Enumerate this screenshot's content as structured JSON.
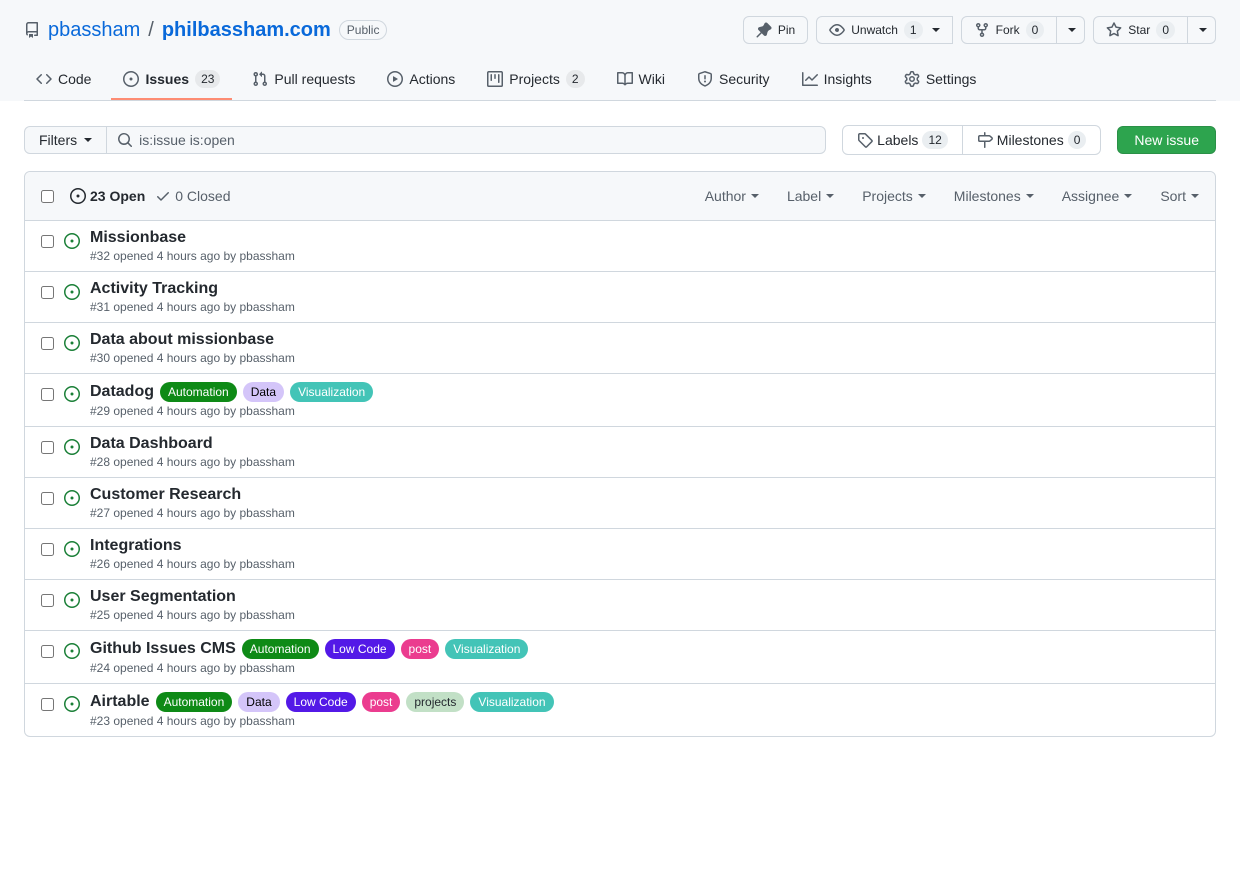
{
  "repo": {
    "owner": "pbassham",
    "name": "philbassham.com",
    "visibility": "Public"
  },
  "actions": {
    "pin": "Pin",
    "unwatch": "Unwatch",
    "watch_count": "1",
    "fork": "Fork",
    "fork_count": "0",
    "star": "Star",
    "star_count": "0"
  },
  "tabs": {
    "code": "Code",
    "issues": "Issues",
    "issues_count": "23",
    "pulls": "Pull requests",
    "actions": "Actions",
    "projects": "Projects",
    "projects_count": "2",
    "wiki": "Wiki",
    "security": "Security",
    "insights": "Insights",
    "settings": "Settings"
  },
  "filters": {
    "button": "Filters",
    "query": "is:issue is:open",
    "labels": "Labels",
    "labels_count": "12",
    "milestones": "Milestones",
    "milestones_count": "0",
    "new_issue": "New issue"
  },
  "list_header": {
    "open": "23 Open",
    "closed": "0 Closed",
    "author": "Author",
    "label": "Label",
    "projects": "Projects",
    "milestones": "Milestones",
    "assignee": "Assignee",
    "sort": "Sort"
  },
  "label_colors": {
    "Automation": {
      "bg": "#0e8a16",
      "fg": "#ffffff"
    },
    "Data": {
      "bg": "#d4c5f9",
      "fg": "#000000"
    },
    "Visualization": {
      "bg": "#43c4b7",
      "fg": "#ffffff"
    },
    "Low Code": {
      "bg": "#5319e7",
      "fg": "#ffffff"
    },
    "post": {
      "bg": "#eb3c8f",
      "fg": "#ffffff"
    },
    "projects": {
      "bg": "#c2e0c6",
      "fg": "#24292f"
    }
  },
  "issues": [
    {
      "title": "Missionbase",
      "number": "32",
      "time": "4 hours ago",
      "author": "pbassham",
      "labels": []
    },
    {
      "title": "Activity Tracking",
      "number": "31",
      "time": "4 hours ago",
      "author": "pbassham",
      "labels": []
    },
    {
      "title": "Data about missionbase",
      "number": "30",
      "time": "4 hours ago",
      "author": "pbassham",
      "labels": []
    },
    {
      "title": "Datadog",
      "number": "29",
      "time": "4 hours ago",
      "author": "pbassham",
      "labels": [
        "Automation",
        "Data",
        "Visualization"
      ]
    },
    {
      "title": "Data Dashboard",
      "number": "28",
      "time": "4 hours ago",
      "author": "pbassham",
      "labels": []
    },
    {
      "title": "Customer Research",
      "number": "27",
      "time": "4 hours ago",
      "author": "pbassham",
      "labels": []
    },
    {
      "title": "Integrations",
      "number": "26",
      "time": "4 hours ago",
      "author": "pbassham",
      "labels": []
    },
    {
      "title": "User Segmentation",
      "number": "25",
      "time": "4 hours ago",
      "author": "pbassham",
      "labels": []
    },
    {
      "title": "Github Issues CMS",
      "number": "24",
      "time": "4 hours ago",
      "author": "pbassham",
      "labels": [
        "Automation",
        "Low Code",
        "post",
        "Visualization"
      ]
    },
    {
      "title": "Airtable",
      "number": "23",
      "time": "4 hours ago",
      "author": "pbassham",
      "labels": [
        "Automation",
        "Data",
        "Low Code",
        "post",
        "projects",
        "Visualization"
      ]
    }
  ]
}
